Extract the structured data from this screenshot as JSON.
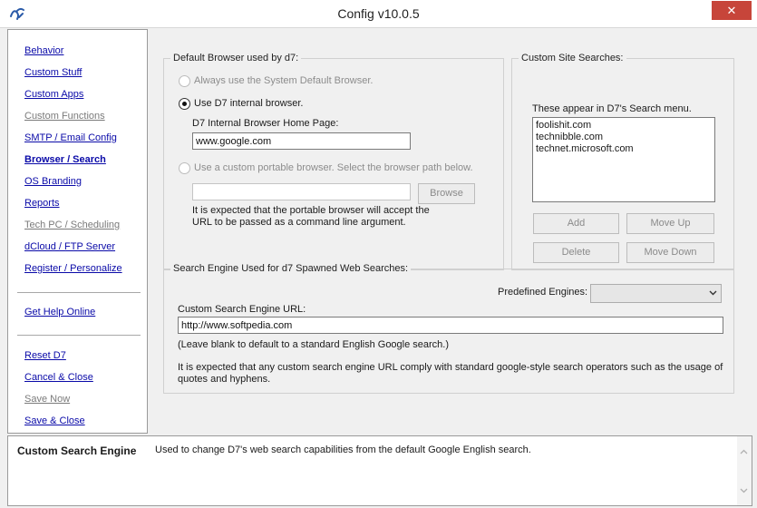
{
  "window": {
    "title": "Config  v10.0.5",
    "close_label": "✕"
  },
  "sidebar": {
    "behavior": "Behavior",
    "custom_stuff": "Custom Stuff",
    "custom_apps": "Custom Apps",
    "custom_functions": "Custom Functions",
    "smtp": "SMTP / Email Config",
    "browser": "Browser / Search",
    "os_branding": "OS Branding",
    "reports": "Reports",
    "tech_pc": "Tech PC / Scheduling",
    "dcloud": "dCloud / FTP Server",
    "register": "Register / Personalize",
    "help": "Get Help Online",
    "reset": "Reset D7",
    "cancel": "Cancel & Close",
    "save_now": "Save Now",
    "save_close": "Save & Close"
  },
  "browser": {
    "group_title": "Default Browser used by d7:",
    "opt_system": "Always use the System Default Browser.",
    "opt_internal": "Use D7 internal browser.",
    "home_label": "D7 Internal Browser Home Page:",
    "home_value": "www.google.com",
    "opt_portable": "Use a custom portable browser.  Select the browser path below.",
    "path_value": "",
    "browse_label": "Browse",
    "note1": "It is expected that the portable browser will accept the",
    "note2": "URL to be passed as a command line argument."
  },
  "site_searches": {
    "group_title": "Custom Site Searches:",
    "hint": "These appear in D7's Search menu.",
    "items": [
      "foolishit.com",
      "technibble.com",
      "technet.microsoft.com"
    ],
    "add": "Add",
    "move_up": "Move Up",
    "delete": "Delete",
    "move_down": "Move Down"
  },
  "engine": {
    "group_title": "Search Engine Used for d7 Spawned Web Searches:",
    "predefined_label": "Predefined Engines:",
    "predefined_value": "",
    "url_label": "Custom Search Engine URL:",
    "url_value": "http://www.softpedia.com",
    "blank_note": "(Leave blank to default to a standard English Google search.)",
    "note1": "It is expected that any custom search engine URL comply with standard google-style search operators such as the usage of",
    "note2": "quotes and hyphens."
  },
  "status": {
    "title": "Custom Search Engine",
    "description": "Used to change D7's web search capabilities from the default Google English search."
  },
  "colors": {
    "link": "#0a0aa8",
    "close": "#c7453a"
  }
}
